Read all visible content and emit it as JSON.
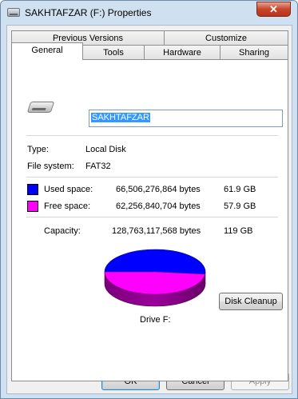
{
  "window": {
    "title": "SAKHTAFZAR (F:) Properties",
    "close_glyph": "✕"
  },
  "tabs": {
    "row1": [
      "Previous Versions",
      "Customize"
    ],
    "row2": [
      "General",
      "Tools",
      "Hardware",
      "Sharing"
    ],
    "active": "General"
  },
  "general": {
    "drive_name": "SAKHTAFZAR",
    "type_label": "Type:",
    "type_value": "Local Disk",
    "fs_label": "File system:",
    "fs_value": "FAT32",
    "used_label": "Used space:",
    "used_bytes": "66,506,276,864 bytes",
    "used_gb": "61.9 GB",
    "free_label": "Free space:",
    "free_bytes": "62,256,840,704 bytes",
    "free_gb": "57.9 GB",
    "capacity_label": "Capacity:",
    "capacity_bytes": "128,763,117,568 bytes",
    "capacity_gb": "119 GB",
    "drive_label": "Drive F:",
    "cleanup_button": "Disk Cleanup",
    "used_fraction": 0.5165,
    "colors": {
      "used": "#0000ff",
      "free": "#ff00ff"
    }
  },
  "buttons": {
    "ok": "OK",
    "cancel": "Cancel",
    "apply": "Apply"
  }
}
